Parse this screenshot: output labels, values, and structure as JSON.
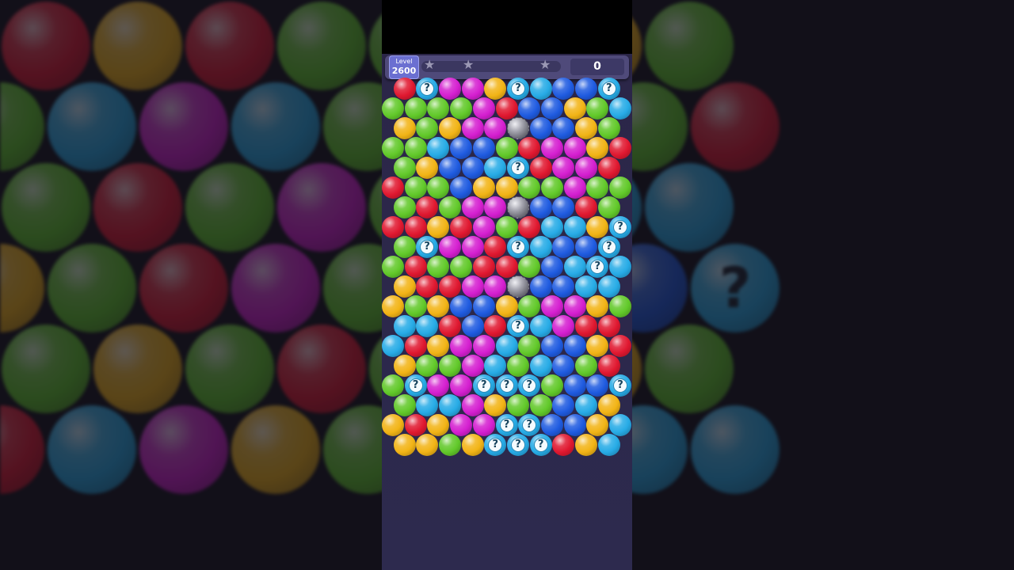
{
  "hud": {
    "level_label": "Level",
    "level_value": "2600",
    "score": "0",
    "stars": [
      "star-icon",
      "star-icon",
      "star-icon"
    ]
  },
  "colors": {
    "red": "#e01830",
    "green": "#62c92a",
    "yellow": "#f2b416",
    "magenta": "#d51fd0",
    "blue": "#1f5be0",
    "cyan": "#27abe6",
    "gray": "#8d8d96"
  },
  "board": {
    "question_mark": "?",
    "rows": [
      "RQMMYQCBBQ",
      "GGGGMRBBYGC",
      "YGYMMXBBYG",
      "GGCBBGRMMYR",
      "GYBBCQRMMR",
      "RGGBYYGGMGG",
      "GRGMMXBBRG",
      "RRYRMGRCCYQ",
      "GQMMRQCBBQ",
      "GRGGRRGBCQC",
      "YRRMMXBBCC",
      "YGYBBYGMMYG",
      "CCRBRQCMRR",
      "CRYMMCGBBYR",
      "YGGMCGCBGR",
      "GQMMQQQGBBQ",
      "GCCMYGGBCY",
      "YRYMMQQBBYC",
      "YYGYQQQRYC"
    ]
  },
  "background": {
    "rows": [
      "RYRGGRYG",
      "GCMCGRYGR",
      "GRGMGCQC",
      "YGRMGBBBQ",
      "GYGRGRYG",
      "RCMYGCBCC"
    ]
  }
}
